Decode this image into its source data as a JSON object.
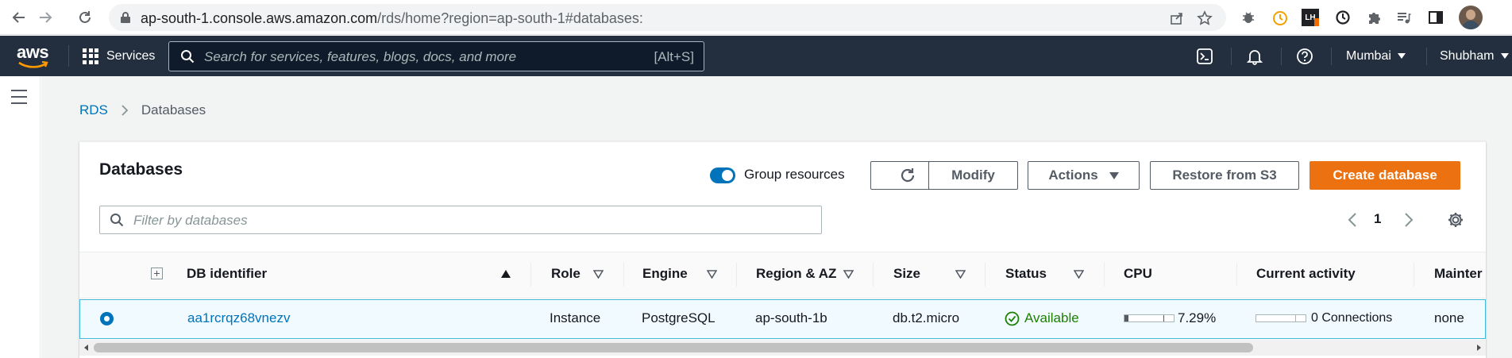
{
  "browser": {
    "url_host": "ap-south-1.console.aws.amazon.com",
    "url_path": "/rds/home?region=ap-south-1#databases:",
    "icons": [
      "back-icon",
      "forward-icon",
      "reload-icon",
      "lock-icon",
      "share-icon",
      "bookmark-star-icon",
      "bug-extension-icon",
      "timer-extension-icon",
      "lh-extension-icon",
      "clock-extension-icon",
      "puzzle-extensions-icon",
      "media-queue-icon",
      "side-panel-icon",
      "profile-avatar"
    ],
    "lh_badge": "LH"
  },
  "aws_header": {
    "logo_text": "aws",
    "services_label": "Services",
    "search_placeholder": "Search for services, features, blogs, docs, and more",
    "search_shortcut": "[Alt+S]",
    "region_label": "Mumbai",
    "user_label": "Shubham",
    "icons": [
      "cloudshell-icon",
      "notifications-bell-icon",
      "help-icon"
    ]
  },
  "breadcrumb": {
    "root": "RDS",
    "current": "Databases"
  },
  "panel": {
    "title": "Databases",
    "group_resources_label": "Group resources",
    "group_resources_on": true,
    "buttons": {
      "modify": "Modify",
      "actions": "Actions",
      "restore": "Restore from S3",
      "create": "Create database"
    },
    "filter_placeholder": "Filter by databases",
    "page_number": "1"
  },
  "table": {
    "columns": {
      "identifier": "DB identifier",
      "role": "Role",
      "engine": "Engine",
      "region": "Region & AZ",
      "size": "Size",
      "status": "Status",
      "cpu": "CPU",
      "activity": "Current activity",
      "maintenance": "Mainter"
    },
    "rows": [
      {
        "selected": true,
        "identifier": "aa1rcrqz68vnezv",
        "role": "Instance",
        "engine": "PostgreSQL",
        "region": "ap-south-1b",
        "size": "db.t2.micro",
        "status": "Available",
        "cpu": "7.29%",
        "cpu_fraction": 0.0729,
        "activity": "0 Connections",
        "maintenance": "none"
      }
    ]
  },
  "colors": {
    "aws_navy": "#232f3e",
    "link_blue": "#0073bb",
    "primary_orange": "#ec7211",
    "status_green": "#1d8102",
    "selected_row_border": "#44b9d6"
  }
}
